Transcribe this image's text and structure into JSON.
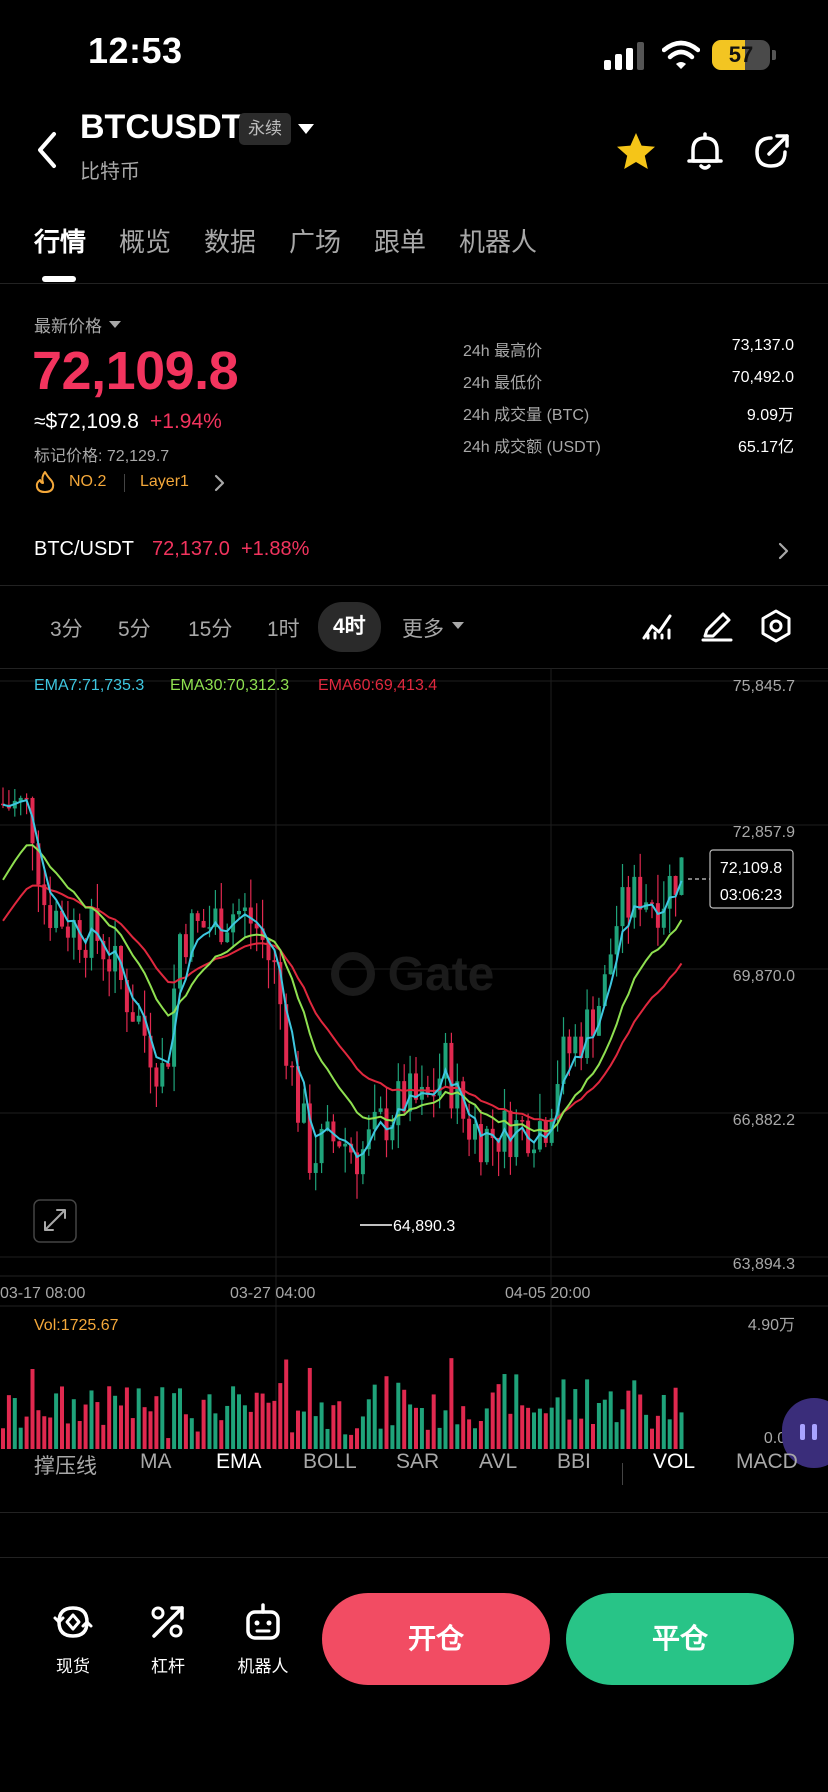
{
  "status_bar": {
    "time": "12:53",
    "battery": "57",
    "battery_level": 0.57
  },
  "header": {
    "title": "BTCUSDT",
    "badge": "永续",
    "subtitle": "比特币",
    "icons": [
      "back-arrow-icon",
      "star-icon",
      "bell-icon",
      "share-icon"
    ],
    "star_color": "#f5c518"
  },
  "tabs": [
    "行情",
    "概览",
    "数据",
    "广场",
    "跟单",
    "机器人"
  ],
  "price_panel": {
    "latest_label": "最新价格",
    "last_price": "72,109.8",
    "usd_price": "≈$72,109.8",
    "change_pct": "+1.94%",
    "mark_price": "标记价格: 72,129.7",
    "rank": "NO.2",
    "tag": "Layer1",
    "stats": [
      {
        "label": "24h 最高价",
        "value": "73,137.0"
      },
      {
        "label": "24h 最低价",
        "value": "70,492.0"
      },
      {
        "label": "24h 成交量 (BTC)",
        "value": "9.09万"
      },
      {
        "label": "24h 成交额 (USDT)",
        "value": "65.17亿"
      }
    ]
  },
  "spot_row": {
    "pair": "BTC/USDT",
    "price": "72,137.0",
    "change": "+1.88%"
  },
  "timeframes": {
    "items": [
      "3分",
      "5分",
      "15分",
      "1时",
      "4时"
    ],
    "active": "4时",
    "more": "更多"
  },
  "chart": {
    "ema_labels": [
      {
        "text": "EMA7:71,735.3",
        "color": "#3ec7e0"
      },
      {
        "text": "EMA30:70,312.3",
        "color": "#9be35a"
      },
      {
        "text": "EMA60:69,413.4",
        "color": "#f23645"
      }
    ],
    "y_ticks": [
      "75,845.7",
      "72,857.9",
      "69,870.0",
      "66,882.2",
      "63,894.3"
    ],
    "x_ticks": [
      "03-17 08:00",
      "03-27 04:00",
      "04-05 20:00"
    ],
    "current_price": "72,109.8",
    "countdown": "03:06:23",
    "low_marker": "64,890.3",
    "vol_label": "Vol:1725.67",
    "vol_max": "4.90万",
    "vol_min": "0.00",
    "up_color": "#1fa37a",
    "down_color": "#e0294f"
  },
  "indicators": {
    "items": [
      "撑压线",
      "MA",
      "EMA",
      "BOLL",
      "SAR",
      "AVL",
      "BBI",
      "VOL",
      "MACD"
    ],
    "active": [
      "EMA",
      "VOL"
    ]
  },
  "bottom_nav": {
    "items": [
      {
        "label": "现货",
        "icon": "spot-icon"
      },
      {
        "label": "杠杆",
        "icon": "leverage-icon"
      },
      {
        "label": "机器人",
        "icon": "robot-icon"
      }
    ],
    "open_label": "开仓",
    "close_label": "平仓"
  }
}
